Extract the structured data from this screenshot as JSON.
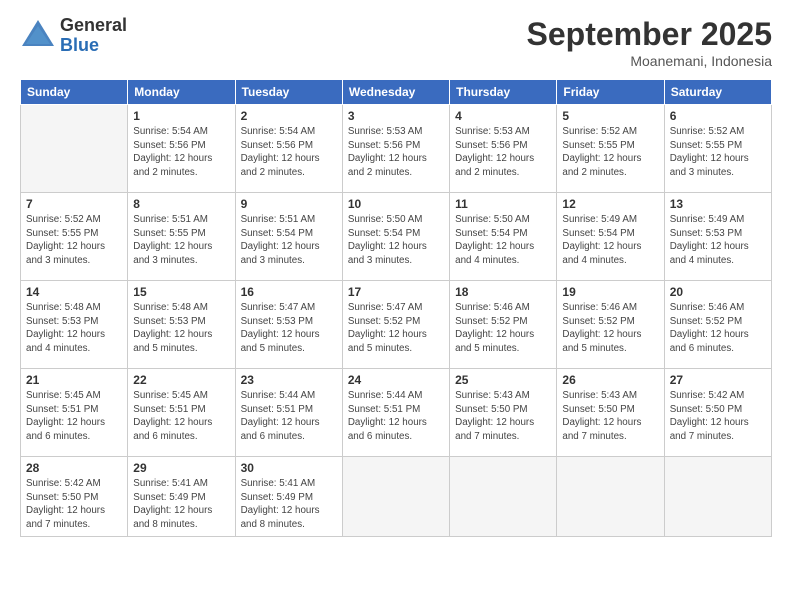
{
  "logo": {
    "general": "General",
    "blue": "Blue"
  },
  "title": "September 2025",
  "location": "Moanemani, Indonesia",
  "days_of_week": [
    "Sunday",
    "Monday",
    "Tuesday",
    "Wednesday",
    "Thursday",
    "Friday",
    "Saturday"
  ],
  "weeks": [
    [
      {
        "day": "",
        "info": ""
      },
      {
        "day": "1",
        "info": "Sunrise: 5:54 AM\nSunset: 5:56 PM\nDaylight: 12 hours\nand 2 minutes."
      },
      {
        "day": "2",
        "info": "Sunrise: 5:54 AM\nSunset: 5:56 PM\nDaylight: 12 hours\nand 2 minutes."
      },
      {
        "day": "3",
        "info": "Sunrise: 5:53 AM\nSunset: 5:56 PM\nDaylight: 12 hours\nand 2 minutes."
      },
      {
        "day": "4",
        "info": "Sunrise: 5:53 AM\nSunset: 5:56 PM\nDaylight: 12 hours\nand 2 minutes."
      },
      {
        "day": "5",
        "info": "Sunrise: 5:52 AM\nSunset: 5:55 PM\nDaylight: 12 hours\nand 2 minutes."
      },
      {
        "day": "6",
        "info": "Sunrise: 5:52 AM\nSunset: 5:55 PM\nDaylight: 12 hours\nand 3 minutes."
      }
    ],
    [
      {
        "day": "7",
        "info": "Sunrise: 5:52 AM\nSunset: 5:55 PM\nDaylight: 12 hours\nand 3 minutes."
      },
      {
        "day": "8",
        "info": "Sunrise: 5:51 AM\nSunset: 5:55 PM\nDaylight: 12 hours\nand 3 minutes."
      },
      {
        "day": "9",
        "info": "Sunrise: 5:51 AM\nSunset: 5:54 PM\nDaylight: 12 hours\nand 3 minutes."
      },
      {
        "day": "10",
        "info": "Sunrise: 5:50 AM\nSunset: 5:54 PM\nDaylight: 12 hours\nand 3 minutes."
      },
      {
        "day": "11",
        "info": "Sunrise: 5:50 AM\nSunset: 5:54 PM\nDaylight: 12 hours\nand 4 minutes."
      },
      {
        "day": "12",
        "info": "Sunrise: 5:49 AM\nSunset: 5:54 PM\nDaylight: 12 hours\nand 4 minutes."
      },
      {
        "day": "13",
        "info": "Sunrise: 5:49 AM\nSunset: 5:53 PM\nDaylight: 12 hours\nand 4 minutes."
      }
    ],
    [
      {
        "day": "14",
        "info": "Sunrise: 5:48 AM\nSunset: 5:53 PM\nDaylight: 12 hours\nand 4 minutes."
      },
      {
        "day": "15",
        "info": "Sunrise: 5:48 AM\nSunset: 5:53 PM\nDaylight: 12 hours\nand 5 minutes."
      },
      {
        "day": "16",
        "info": "Sunrise: 5:47 AM\nSunset: 5:53 PM\nDaylight: 12 hours\nand 5 minutes."
      },
      {
        "day": "17",
        "info": "Sunrise: 5:47 AM\nSunset: 5:52 PM\nDaylight: 12 hours\nand 5 minutes."
      },
      {
        "day": "18",
        "info": "Sunrise: 5:46 AM\nSunset: 5:52 PM\nDaylight: 12 hours\nand 5 minutes."
      },
      {
        "day": "19",
        "info": "Sunrise: 5:46 AM\nSunset: 5:52 PM\nDaylight: 12 hours\nand 5 minutes."
      },
      {
        "day": "20",
        "info": "Sunrise: 5:46 AM\nSunset: 5:52 PM\nDaylight: 12 hours\nand 6 minutes."
      }
    ],
    [
      {
        "day": "21",
        "info": "Sunrise: 5:45 AM\nSunset: 5:51 PM\nDaylight: 12 hours\nand 6 minutes."
      },
      {
        "day": "22",
        "info": "Sunrise: 5:45 AM\nSunset: 5:51 PM\nDaylight: 12 hours\nand 6 minutes."
      },
      {
        "day": "23",
        "info": "Sunrise: 5:44 AM\nSunset: 5:51 PM\nDaylight: 12 hours\nand 6 minutes."
      },
      {
        "day": "24",
        "info": "Sunrise: 5:44 AM\nSunset: 5:51 PM\nDaylight: 12 hours\nand 6 minutes."
      },
      {
        "day": "25",
        "info": "Sunrise: 5:43 AM\nSunset: 5:50 PM\nDaylight: 12 hours\nand 7 minutes."
      },
      {
        "day": "26",
        "info": "Sunrise: 5:43 AM\nSunset: 5:50 PM\nDaylight: 12 hours\nand 7 minutes."
      },
      {
        "day": "27",
        "info": "Sunrise: 5:42 AM\nSunset: 5:50 PM\nDaylight: 12 hours\nand 7 minutes."
      }
    ],
    [
      {
        "day": "28",
        "info": "Sunrise: 5:42 AM\nSunset: 5:50 PM\nDaylight: 12 hours\nand 7 minutes."
      },
      {
        "day": "29",
        "info": "Sunrise: 5:41 AM\nSunset: 5:49 PM\nDaylight: 12 hours\nand 8 minutes."
      },
      {
        "day": "30",
        "info": "Sunrise: 5:41 AM\nSunset: 5:49 PM\nDaylight: 12 hours\nand 8 minutes."
      },
      {
        "day": "",
        "info": ""
      },
      {
        "day": "",
        "info": ""
      },
      {
        "day": "",
        "info": ""
      },
      {
        "day": "",
        "info": ""
      }
    ]
  ]
}
